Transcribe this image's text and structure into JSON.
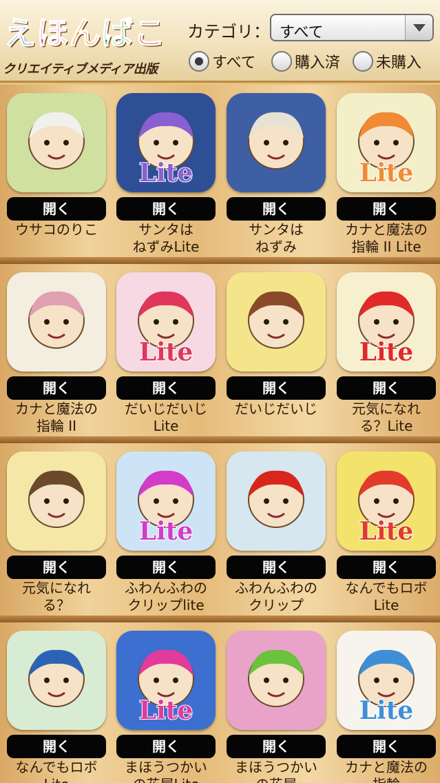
{
  "header": {
    "logo": [
      "え",
      "ほ",
      "ん",
      "ば",
      "こ"
    ],
    "publisher": "クリエイティブメディア出版",
    "category_label": "カテゴリ：",
    "category_value": "すべて",
    "filters": [
      {
        "label": "すべて",
        "selected": true
      },
      {
        "label": "購入済",
        "selected": false
      },
      {
        "label": "未購入",
        "selected": false
      }
    ]
  },
  "open_label": "開く",
  "books": [
    {
      "title": "ウサコのりこ",
      "lite": false,
      "bg": "#cfe0a0",
      "accent": "#f1f1ec",
      "icon": "rabbit-bear-cover-icon"
    },
    {
      "title": "サンタは\nねずみLite",
      "lite": true,
      "bg": "#2e4f95",
      "accent": "#8a5fd1",
      "icon": "santa-mouse-lite-cover-icon"
    },
    {
      "title": "サンタは\nねずみ",
      "lite": false,
      "bg": "#3f5fa5",
      "accent": "#e8e2d4",
      "icon": "santa-mouse-cover-icon"
    },
    {
      "title": "カナと魔法の\n指輪 II Lite",
      "lite": true,
      "bg": "#f2efc9",
      "accent": "#f08a34",
      "icon": "kana-ring-lite-cover-icon"
    },
    {
      "title": "カナと魔法の\n指輪 II",
      "lite": false,
      "bg": "#f3eedf",
      "accent": "#e0a0b0",
      "icon": "kana-ring-cover-icon"
    },
    {
      "title": "だいじだいじ\nLite",
      "lite": true,
      "bg": "#f6d9e2",
      "accent": "#e0365c",
      "icon": "daiji-lite-cover-icon"
    },
    {
      "title": "だいじだいじ",
      "lite": false,
      "bg": "#f5e58a",
      "accent": "#8a4a2a",
      "icon": "daiji-cover-icon"
    },
    {
      "title": "元気になれ\nる？Lite",
      "lite": true,
      "bg": "#f6f0cf",
      "accent": "#e02a2a",
      "icon": "genki-lite-cover-icon"
    },
    {
      "title": "元気になれ\nる？",
      "lite": false,
      "bg": "#f5e7a6",
      "accent": "#6a4a2a",
      "icon": "genki-cover-icon"
    },
    {
      "title": "ふわんふわの\nクリップlite",
      "lite": true,
      "bg": "#cde4f6",
      "accent": "#d33bc9",
      "icon": "fuwan-clip-lite-cover-icon"
    },
    {
      "title": "ふわんふわの\nクリップ",
      "lite": false,
      "bg": "#d6e7ef",
      "accent": "#d8261d",
      "icon": "fuwan-clip-cover-icon"
    },
    {
      "title": "なんでもロボ\nLite",
      "lite": true,
      "bg": "#f3e36c",
      "accent": "#e23b2b",
      "icon": "robo-lite-cover-icon"
    },
    {
      "title": "なんでもロボ\nLite",
      "lite": false,
      "bg": "#d8ecd4",
      "accent": "#2d63b6",
      "icon": "robo-cover-icon"
    },
    {
      "title": "まほうつかい\nの花屋Lite",
      "lite": true,
      "bg": "#3d6fd0",
      "accent": "#e23b9b",
      "icon": "mahou-flower-lite-cover-icon"
    },
    {
      "title": "まほうつかい\nの花屋",
      "lite": false,
      "bg": "#e9a3c9",
      "accent": "#6bc23c",
      "icon": "mahou-flower-cover-icon"
    },
    {
      "title": "カナと魔法の\n指輪",
      "lite": true,
      "bg": "#f7f4ee",
      "accent": "#3f8fd6",
      "icon": "kana-ring-1-lite-cover-icon"
    }
  ],
  "lite_text": "Lite"
}
